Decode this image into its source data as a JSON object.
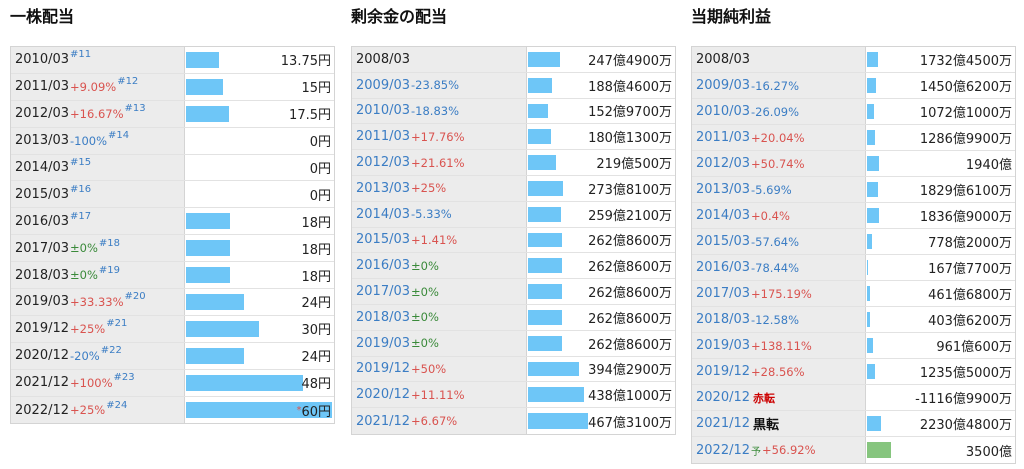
{
  "panels": [
    {
      "title": "一株配当",
      "rows": [
        {
          "year": "2010/03",
          "change": "",
          "dir": "",
          "ref": "#11",
          "value": "13.75円",
          "ratio": 0.229
        },
        {
          "year": "2011/03",
          "change": "+9.09%",
          "dir": "pos",
          "ref": "#12",
          "value": "15円",
          "ratio": 0.25
        },
        {
          "year": "2012/03",
          "change": "+16.67%",
          "dir": "pos",
          "ref": "#13",
          "value": "17.5円",
          "ratio": 0.292
        },
        {
          "year": "2013/03",
          "change": "-100%",
          "dir": "neg",
          "ref": "#14",
          "value": "0円",
          "ratio": 0
        },
        {
          "year": "2014/03",
          "change": "",
          "dir": "",
          "ref": "#15",
          "value": "0円",
          "ratio": 0
        },
        {
          "year": "2015/03",
          "change": "",
          "dir": "",
          "ref": "#16",
          "value": "0円",
          "ratio": 0
        },
        {
          "year": "2016/03",
          "change": "",
          "dir": "",
          "ref": "#17",
          "value": "18円",
          "ratio": 0.3
        },
        {
          "year": "2017/03",
          "change": "±0%",
          "dir": "zero",
          "ref": "#18",
          "value": "18円",
          "ratio": 0.3
        },
        {
          "year": "2018/03",
          "change": "±0%",
          "dir": "zero",
          "ref": "#19",
          "value": "18円",
          "ratio": 0.3
        },
        {
          "year": "2019/03",
          "change": "+33.33%",
          "dir": "pos",
          "ref": "#20",
          "value": "24円",
          "ratio": 0.4
        },
        {
          "year": "2019/12",
          "change": "+25%",
          "dir": "pos",
          "ref": "#21",
          "value": "30円",
          "ratio": 0.5
        },
        {
          "year": "2020/12",
          "change": "-20%",
          "dir": "neg",
          "ref": "#22",
          "value": "24円",
          "ratio": 0.4
        },
        {
          "year": "2021/12",
          "change": "+100%",
          "dir": "pos",
          "ref": "#23",
          "value": "48円",
          "ratio": 0.8
        },
        {
          "year": "2022/12",
          "change": "+25%",
          "dir": "pos",
          "ref": "#24",
          "value": "60円",
          "mark": "*",
          "ratio": 1.0
        }
      ]
    },
    {
      "title": "剰余金の配当",
      "rows": [
        {
          "year": "2008/03",
          "change": "",
          "dir": "",
          "value": "247億4900万",
          "ratio": 0.53,
          "plain": true
        },
        {
          "year": "2009/03",
          "change": "-23.85%",
          "dir": "neg",
          "value": "188億4600万",
          "ratio": 0.404
        },
        {
          "year": "2010/03",
          "change": "-18.83%",
          "dir": "neg",
          "value": "152億9700万",
          "ratio": 0.328
        },
        {
          "year": "2011/03",
          "change": "+17.76%",
          "dir": "pos",
          "value": "180億1300万",
          "ratio": 0.386
        },
        {
          "year": "2012/03",
          "change": "+21.61%",
          "dir": "pos",
          "value": "219億500万",
          "ratio": 0.469
        },
        {
          "year": "2013/03",
          "change": "+25%",
          "dir": "pos",
          "value": "273億8100万",
          "ratio": 0.587
        },
        {
          "year": "2014/03",
          "change": "-5.33%",
          "dir": "neg",
          "value": "259億2100万",
          "ratio": 0.555
        },
        {
          "year": "2015/03",
          "change": "+1.41%",
          "dir": "pos",
          "value": "262億8600万",
          "ratio": 0.563
        },
        {
          "year": "2016/03",
          "change": "±0%",
          "dir": "zero",
          "value": "262億8600万",
          "ratio": 0.563
        },
        {
          "year": "2017/03",
          "change": "±0%",
          "dir": "zero",
          "value": "262億8600万",
          "ratio": 0.563
        },
        {
          "year": "2018/03",
          "change": "±0%",
          "dir": "zero",
          "value": "262億8600万",
          "ratio": 0.563
        },
        {
          "year": "2019/03",
          "change": "±0%",
          "dir": "zero",
          "value": "262億8600万",
          "ratio": 0.563
        },
        {
          "year": "2019/12",
          "change": "+50%",
          "dir": "pos",
          "value": "394億2900万",
          "ratio": 0.844
        },
        {
          "year": "2020/12",
          "change": "+11.11%",
          "dir": "pos",
          "value": "438億1000万",
          "ratio": 0.938
        },
        {
          "year": "2021/12",
          "change": "+6.67%",
          "dir": "pos",
          "value": "467億3100万",
          "ratio": 1.0
        }
      ]
    },
    {
      "title": "当期純利益",
      "rows": [
        {
          "year": "2008/03",
          "change": "",
          "dir": "",
          "value": "1732億4500万",
          "ratio": 0.776,
          "plain": true
        },
        {
          "year": "2009/03",
          "change": "-16.27%",
          "dir": "neg",
          "value": "1450億6200万",
          "ratio": 0.65
        },
        {
          "year": "2010/03",
          "change": "-26.09%",
          "dir": "neg",
          "value": "1072億1000万",
          "ratio": 0.48
        },
        {
          "year": "2011/03",
          "change": "+20.04%",
          "dir": "pos",
          "value": "1286億9900万",
          "ratio": 0.577
        },
        {
          "year": "2012/03",
          "change": "+50.74%",
          "dir": "pos",
          "value": "1940億",
          "ratio": 0.87
        },
        {
          "year": "2013/03",
          "change": "-5.69%",
          "dir": "neg",
          "value": "1829億6100万",
          "ratio": 0.82
        },
        {
          "year": "2014/03",
          "change": "+0.4%",
          "dir": "pos",
          "value": "1836億9000万",
          "ratio": 0.823
        },
        {
          "year": "2015/03",
          "change": "-57.64%",
          "dir": "neg",
          "value": "778億2000万",
          "ratio": 0.349
        },
        {
          "year": "2016/03",
          "change": "-78.44%",
          "dir": "neg",
          "value": "167億7700万",
          "ratio": 0.075
        },
        {
          "year": "2017/03",
          "change": "+175.19%",
          "dir": "pos",
          "value": "461億6800万",
          "ratio": 0.207
        },
        {
          "year": "2018/03",
          "change": "-12.58%",
          "dir": "neg",
          "value": "403億6200万",
          "ratio": 0.181
        },
        {
          "year": "2019/03",
          "change": "+138.11%",
          "dir": "pos",
          "value": "961億600万",
          "ratio": 0.431
        },
        {
          "year": "2019/12",
          "change": "+28.56%",
          "dir": "pos",
          "value": "1235億5000万",
          "ratio": 0.554
        },
        {
          "year": "2020/12",
          "change": "",
          "dir": "",
          "flag": "赤転",
          "value": "-1116億9900万",
          "ratio": 0
        },
        {
          "year": "2021/12",
          "change": "",
          "dir": "",
          "flag": "黒転",
          "flagClass": "black",
          "value": "2230億4800万",
          "ratio": 1.0
        },
        {
          "year": "2022/12",
          "change": "+56.92%",
          "dir": "pos",
          "yosou": "予",
          "value": "3500億",
          "ratio": 1.0,
          "green": true
        }
      ]
    }
  ]
}
